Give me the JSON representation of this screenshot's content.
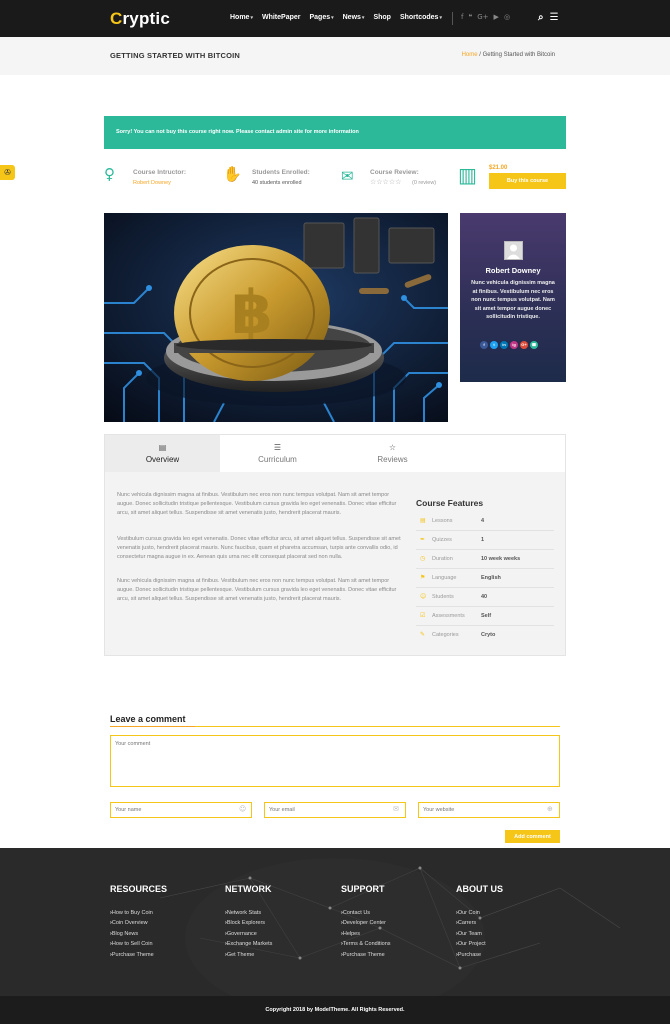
{
  "header": {
    "logo_first": "C",
    "logo_rest": "ryptic",
    "nav": [
      "Home",
      "WhitePaper",
      "Pages",
      "News",
      "Shop",
      "Shortcodes"
    ],
    "social_icons": [
      "facebook-icon",
      "twitter-icon",
      "google-plus-icon",
      "youtube-icon",
      "instagram-icon"
    ],
    "social_glyphs": [
      "f",
      "❝",
      "G+",
      "▶",
      "◎"
    ]
  },
  "title_bar": {
    "title": "GETTING STARTED WITH BITCOIN",
    "breadcrumb_home": "Home",
    "breadcrumb_sep": " / ",
    "breadcrumb_current": "Getting Started with Bitcoin"
  },
  "alert": "Sorry! You can not buy this course right now. Please contact admin site for more information",
  "course_meta": {
    "instructor_label": "Course Intructor:",
    "instructor_name": "Robert Downey",
    "students_label": "Students Enrolled:",
    "students_value": "40 students enrolled",
    "review_label": "Course Review:",
    "review_stars": "☆☆☆☆☆",
    "review_count": "(0 review)",
    "rating": 0,
    "price": "$21.00",
    "buy_label": "Buy this course"
  },
  "instructor_card": {
    "name": "Robert Downey",
    "bio": "Nunc vehicula dignissim magna at finibus. Vestibulum nec eros non nunc tempus volutpat. Nam sit amet tempor augue donec sollicitudin tristique.",
    "social": [
      {
        "icon": "facebook-icon",
        "glyph": "f",
        "color": "#3b5998"
      },
      {
        "icon": "twitter-icon",
        "glyph": "t",
        "color": "#1da1f2"
      },
      {
        "icon": "linkedin-icon",
        "glyph": "in",
        "color": "#0077b5"
      },
      {
        "icon": "instagram-icon",
        "glyph": "ig",
        "color": "#c13584"
      },
      {
        "icon": "google-plus-icon",
        "glyph": "G+",
        "color": "#dd4b39"
      },
      {
        "icon": "phone-icon",
        "glyph": "☎",
        "color": "#2bb99a"
      }
    ]
  },
  "tabs": [
    {
      "label": "Overview",
      "icon": "overview-icon",
      "glyph": "▤"
    },
    {
      "label": "Curriculum",
      "icon": "curriculum-icon",
      "glyph": "☰"
    },
    {
      "label": "Reviews",
      "icon": "star-icon",
      "glyph": "☆"
    }
  ],
  "overview": {
    "paragraphs": [
      "Nunc vehicula dignissim magna at finibus. Vestibulum nec eros non nunc tempus volutpat. Nam sit amet tempor augue. Donec sollicitudin tristique pellentesque. Vestibulum cursus gravida leo eget venenatis. Donec vitae efficitur arcu, sit amet aliquet tellus. Suspendisse sit amet venenatis justo, hendrerit placerat mauris.",
      "Vestibulum cursus gravida leo eget venenatis. Donec vitae efficitur arcu, sit amet aliquet tellus. Suspendisse sit amet venenatis justo, hendrerit placerat mauris. Nunc faucibus, quam et pharetra accumsan, turpis ante convallis odio, id consectetur magna augue in ex. Aenean quis urna nec elit consequat placerat sed non nulla.",
      "Nunc vehicula dignissim magna at finibus. Vestibulum nec eros non nunc tempus volutpat. Nam sit amet tempor augue. Donec sollicitudin tristique pellentesque. Vestibulum cursus gravida leo eget venenatis. Donec vitae efficitur arcu, sit amet aliquet tellus. Suspendisse sit amet venenatis justo, hendrerit placerat mauris."
    ]
  },
  "features": {
    "title": "Course Features",
    "rows": [
      {
        "label": "Lessons",
        "value": "4",
        "icon": "lessons-icon",
        "glyph": "▤"
      },
      {
        "label": "Quizzes",
        "value": "1",
        "icon": "quiz-icon",
        "glyph": "✒"
      },
      {
        "label": "Duration",
        "value": "10 week weeks",
        "icon": "clock-icon",
        "glyph": "◷"
      },
      {
        "label": "Language",
        "value": "English",
        "icon": "language-icon",
        "glyph": "⚑"
      },
      {
        "label": "Students",
        "value": "40",
        "icon": "students-icon",
        "glyph": "☺"
      },
      {
        "label": "Assessments",
        "value": "Self",
        "icon": "assessment-icon",
        "glyph": "☑"
      },
      {
        "label": "Categories",
        "value": "Cryto",
        "icon": "category-icon",
        "glyph": "✎"
      }
    ]
  },
  "comment": {
    "title": "Leave a comment",
    "comment_placeholder": "Your comment",
    "name_placeholder": "Your name",
    "email_placeholder": "Your email",
    "website_placeholder": "Your website",
    "submit": "Add comment"
  },
  "footer": {
    "columns": [
      {
        "title": "RESOURCES",
        "links": [
          "How to Buy Coin",
          "Coin Overview",
          "Blog News",
          "How to Sell Coin",
          "Purchase Theme"
        ]
      },
      {
        "title": "NETWORK",
        "links": [
          "Network Stats",
          "Block Explorers",
          "Governance",
          "Exchange Markets",
          "Get Theme"
        ]
      },
      {
        "title": "SUPPORT",
        "links": [
          "Contact Us",
          "Developer Center",
          "Helpes",
          "Terms & Conditions",
          "Purchase Theme"
        ]
      },
      {
        "title": "ABOUT US",
        "links": [
          "Our Coin",
          "Carrers",
          "Our Team",
          "Our Project",
          "Purchase"
        ]
      }
    ],
    "copyright": "Copyright 2018 by ModelTheme. All Rights Reserved."
  },
  "colors": {
    "accent": "#f5c518",
    "teal": "#2bb99a",
    "dark": "#1a1a1a"
  }
}
